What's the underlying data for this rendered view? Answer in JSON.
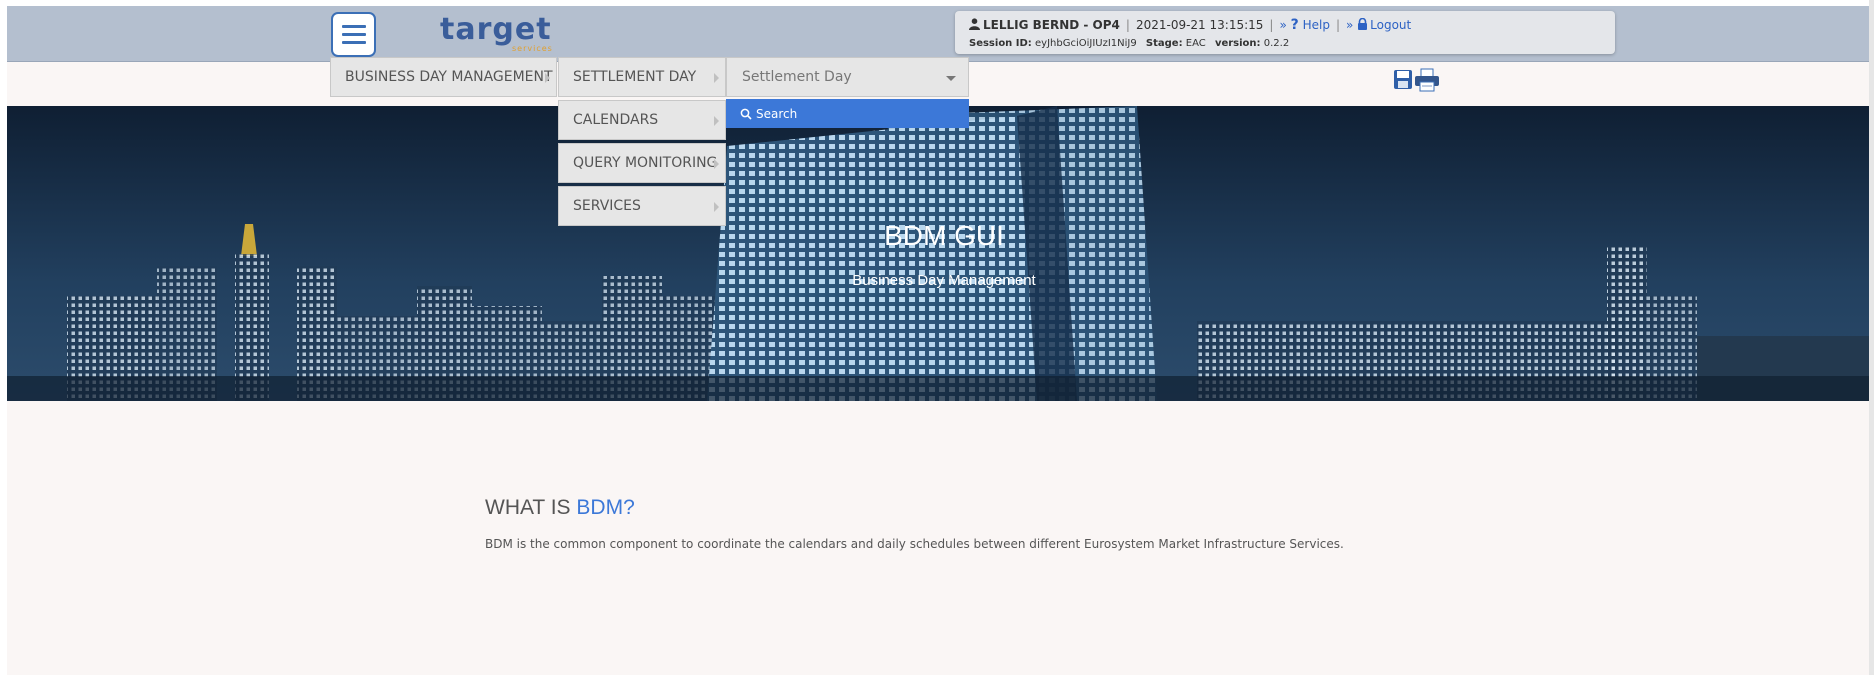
{
  "header": {
    "logo_text": "target",
    "logo_subtext": "services",
    "user": "LELLIG BERND - OP4",
    "datetime": "2021-09-21 13:15:15",
    "help_label": "Help",
    "logout_label": "Logout",
    "session_id_label": "Session ID:",
    "session_id": "eyJhbGciOiJIUzI1NiJ9",
    "stage_label": "Stage:",
    "stage": "EAC",
    "version_label": "version:",
    "version": "0.2.2"
  },
  "menu": {
    "business_day_management": "BUSINESS DAY MANAGEMENT",
    "settlement_day": "SETTLEMENT DAY",
    "calendars": "CALENDARS",
    "query_monitoring": "QUERY MONITORING",
    "services": "SERVICES",
    "dropdown_selected": "Settlement Day",
    "search_option": "Search"
  },
  "hero": {
    "title": "BDM GUI",
    "subtitle": "Business Day Management"
  },
  "content": {
    "heading_prefix": "WHAT IS ",
    "heading_accent": "BDM?",
    "description": "BDM is the common component to coordinate the calendars and daily schedules between different Eurosystem Market Infrastructure Services."
  },
  "colors": {
    "header_bg": "#b4bfcf",
    "accent_blue": "#3c78d8",
    "page_bg": "#faf6f5"
  }
}
